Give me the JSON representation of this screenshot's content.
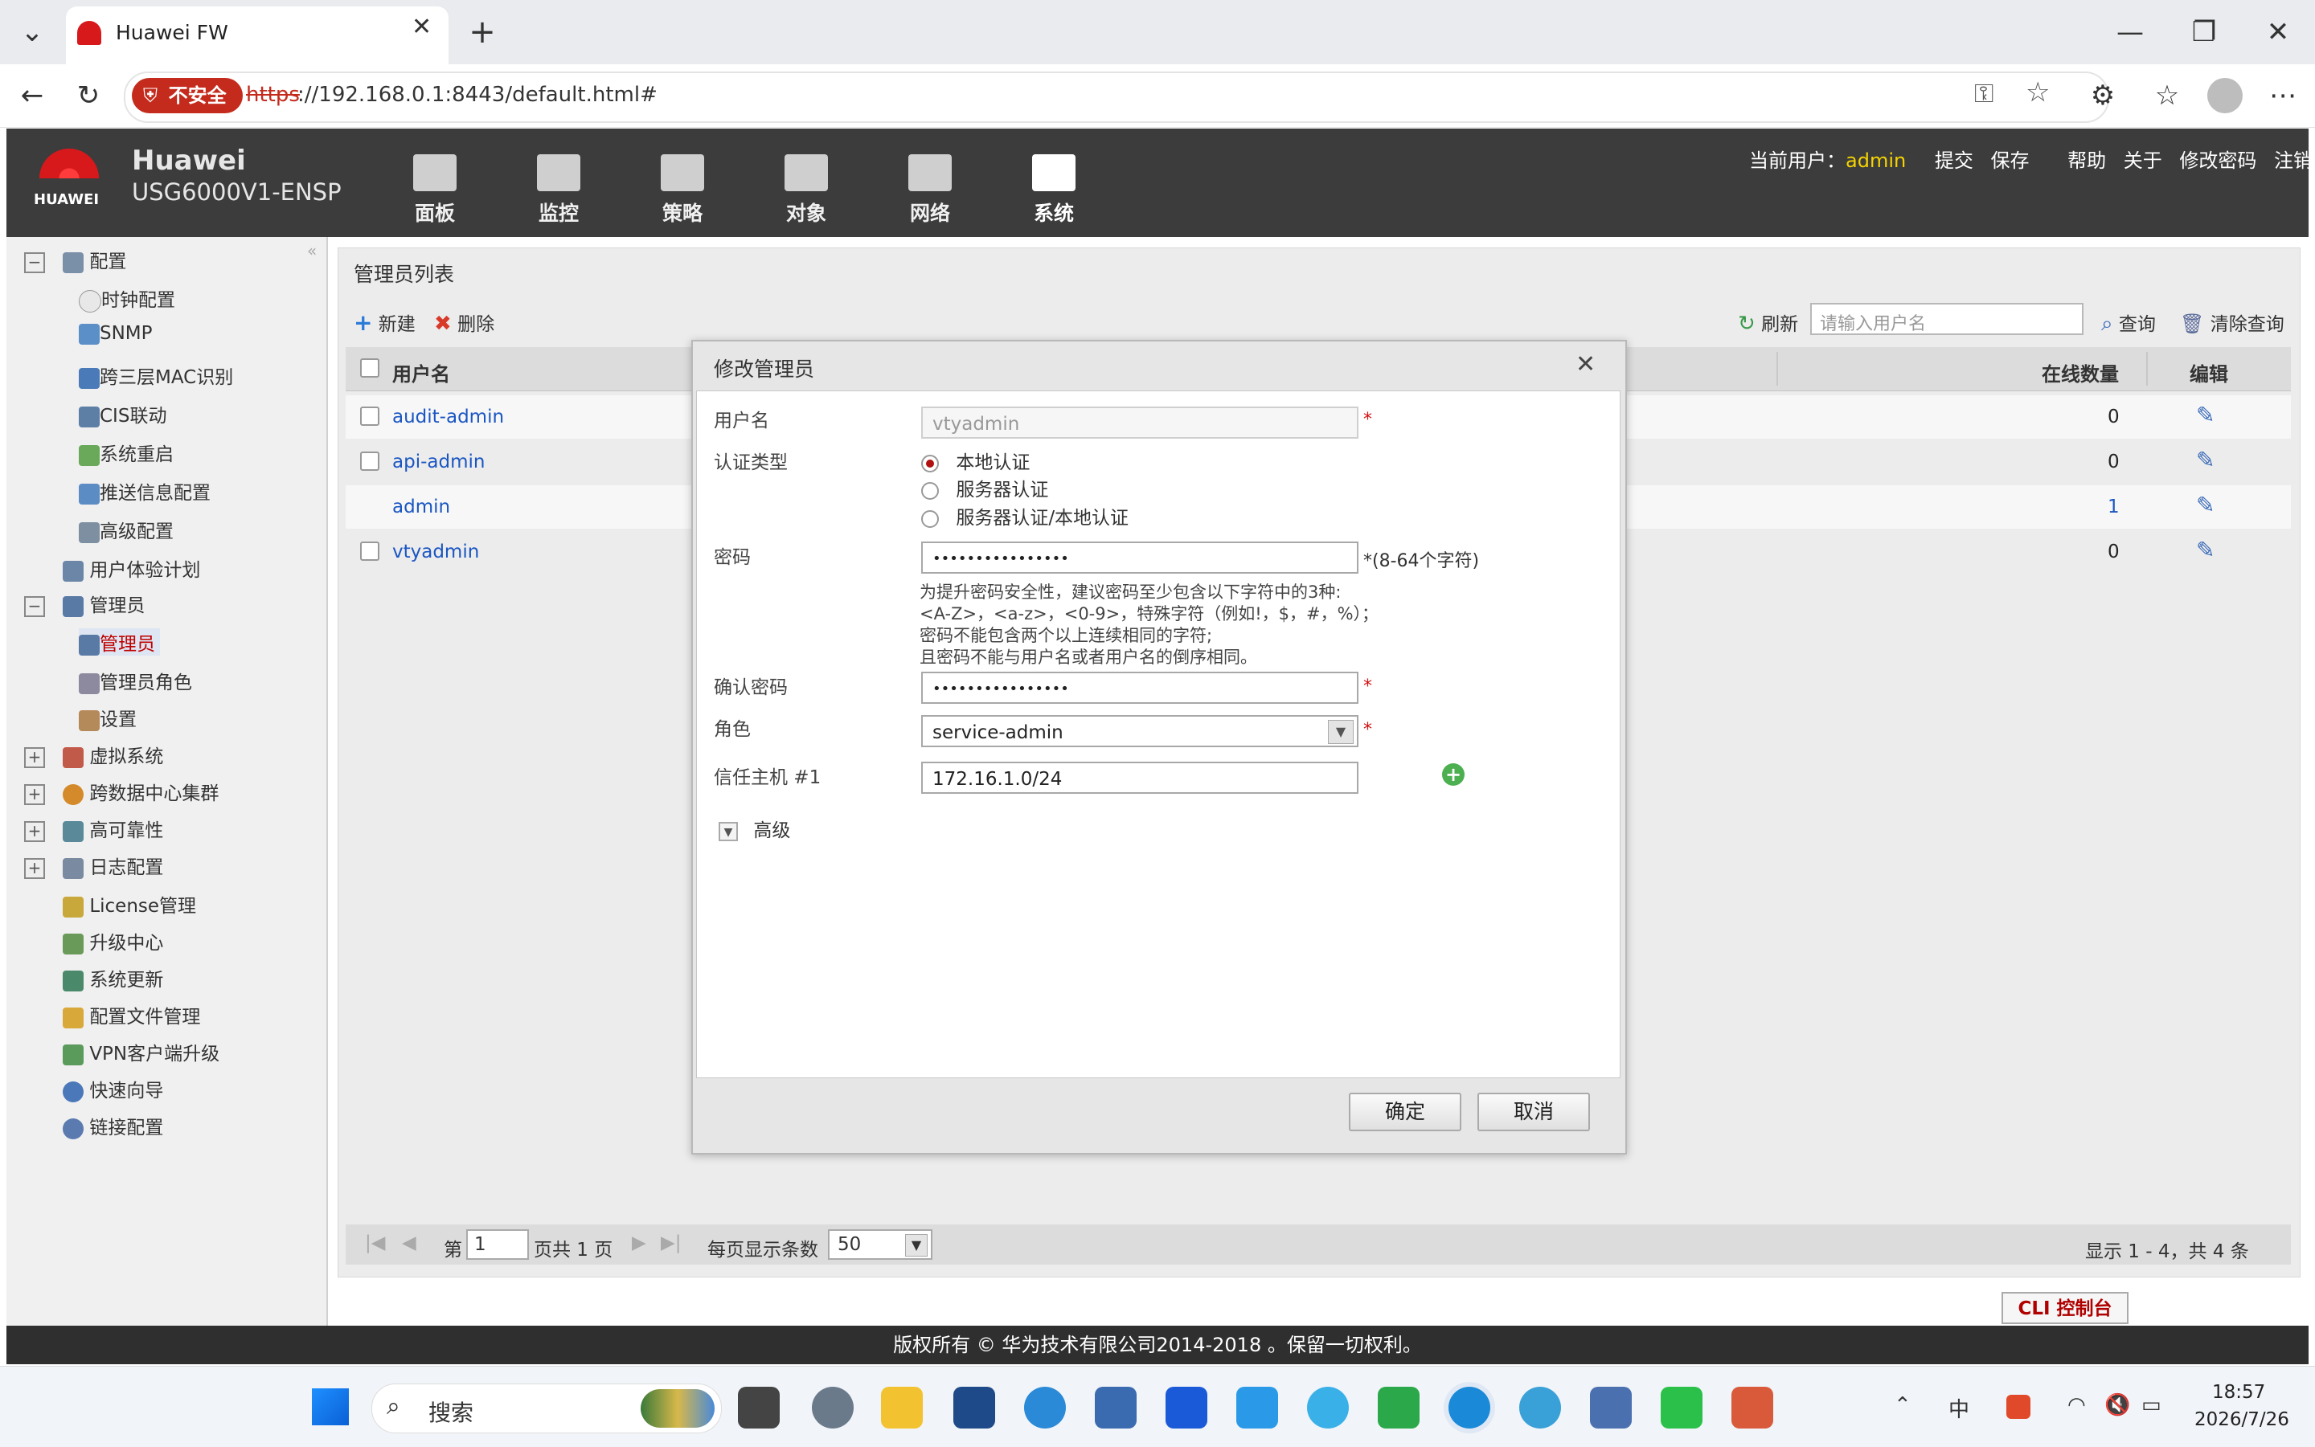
{
  "browser": {
    "tab_title": "Huawei FW",
    "security_badge": "不安全",
    "url_scheme": "https",
    "url_rest": "://192.168.0.1:8443/default.html#"
  },
  "header": {
    "brand": "Huawei",
    "model": "USG6000V1-ENSP",
    "logo_text": "HUAWEI",
    "nav": [
      "面板",
      "监控",
      "策略",
      "对象",
      "网络",
      "系统"
    ],
    "current_user_label": "当前用户：",
    "current_user": "admin",
    "links": [
      "提交",
      "保存",
      "帮助",
      "关于",
      "修改密码",
      "注销"
    ]
  },
  "sidebar": {
    "items": [
      {
        "label": "配置",
        "level": 0,
        "toggle": "−"
      },
      {
        "label": "时钟配置",
        "level": 1
      },
      {
        "label": "SNMP",
        "level": 1
      },
      {
        "label": "跨三层MAC识别",
        "level": 1
      },
      {
        "label": "CIS联动",
        "level": 1
      },
      {
        "label": "系统重启",
        "level": 1
      },
      {
        "label": "推送信息配置",
        "level": 1
      },
      {
        "label": "高级配置",
        "level": 1
      },
      {
        "label": "用户体验计划",
        "level": 0
      },
      {
        "label": "管理员",
        "level": 0,
        "toggle": "−"
      },
      {
        "label": "管理员",
        "level": 1,
        "selected": true
      },
      {
        "label": "管理员角色",
        "level": 1
      },
      {
        "label": "设置",
        "level": 1
      },
      {
        "label": "虚拟系统",
        "level": 0,
        "toggle": "+"
      },
      {
        "label": "跨数据中心集群",
        "level": 0,
        "toggle": "+"
      },
      {
        "label": "高可靠性",
        "level": 0,
        "toggle": "+"
      },
      {
        "label": "日志配置",
        "level": 0,
        "toggle": "+"
      },
      {
        "label": "License管理",
        "level": 0
      },
      {
        "label": "升级中心",
        "level": 0
      },
      {
        "label": "系统更新",
        "level": 0
      },
      {
        "label": "配置文件管理",
        "level": 0
      },
      {
        "label": "VPN客户端升级",
        "level": 0
      },
      {
        "label": "快速向导",
        "level": 0
      },
      {
        "label": "链接配置",
        "level": 0
      }
    ]
  },
  "list": {
    "title": "管理员列表",
    "new_label": "新建",
    "delete_label": "删除",
    "refresh_label": "刷新",
    "search_placeholder": "请输入用户名",
    "query_label": "查询",
    "clear_query_label": "清除查询",
    "columns": {
      "username": "用户名",
      "online": "在线数量",
      "edit": "编辑"
    },
    "rows": [
      {
        "username": "audit-admin",
        "online": "0"
      },
      {
        "username": "api-admin",
        "online": "0"
      },
      {
        "username": "admin",
        "online": "1"
      },
      {
        "username": "vtyadmin",
        "online": "0"
      }
    ],
    "pager": {
      "page_prefix": "第",
      "page_value": "1",
      "page_suffix": "页共 1 页",
      "per_page_label": "每页显示条数",
      "per_page_value": "50",
      "summary": "显示 1 - 4，共 4 条"
    }
  },
  "modal": {
    "title": "修改管理员",
    "username_label": "用户名",
    "username_value": "vtyadmin",
    "auth_label": "认证类型",
    "auth_options": [
      "本地认证",
      "服务器认证",
      "服务器认证/本地认证"
    ],
    "auth_selected": 0,
    "password_label": "密码",
    "password_value": "••••••••••••••••",
    "password_hint": "*(8-64个字符)",
    "password_tips": [
      "为提升密码安全性，建议密码至少包含以下字符中的3种:",
      "<A-Z>，<a-z>，<0-9>，特殊字符（例如!，$，#，%）；",
      "密码不能包含两个以上连续相同的字符;",
      "且密码不能与用户名或者用户名的倒序相同。"
    ],
    "confirm_label": "确认密码",
    "confirm_value": "••••••••••••••••",
    "role_label": "角色",
    "role_value": "service-admin",
    "trusted_label": "信任主机 #1",
    "trusted_value": "172.16.1.0/24",
    "advanced_label": "高级",
    "required_mark": "*",
    "ok_label": "确定",
    "cancel_label": "取消"
  },
  "cli_label": "CLI 控制台",
  "footer": "版权所有 © 华为技术有限公司2014-2018 。保留一切权利。",
  "taskbar": {
    "search_label": "搜索",
    "ime": "中",
    "time": "18:57",
    "date": "2026/7/26"
  },
  "colors": {
    "header_bg": "#3c3c3c",
    "current_user": "#f5d300",
    "link": "#1a56c2",
    "required": "#d11111",
    "security_badge": "#c42b1c",
    "cli_text": "#b00000"
  }
}
